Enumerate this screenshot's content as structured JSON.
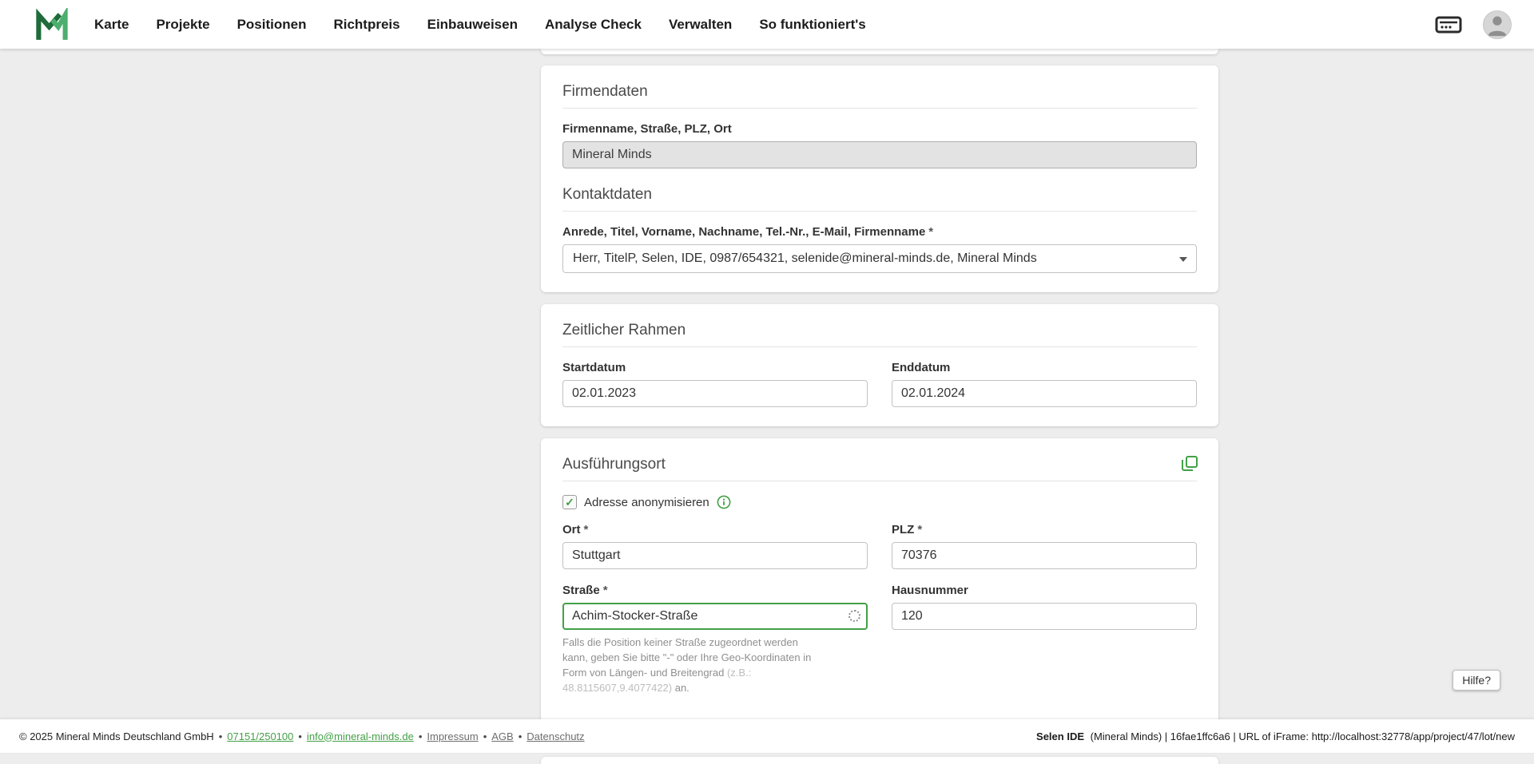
{
  "nav": {
    "items": [
      "Karte",
      "Projekte",
      "Positionen",
      "Richtpreis",
      "Einbauweisen",
      "Analyse Check",
      "Verwalten",
      "So funktioniert's"
    ]
  },
  "icons": {
    "check": "✓"
  },
  "required_marker": "*",
  "cards": {
    "company": {
      "section1_title": "Firmendaten",
      "company_label": "Firmenname, Straße, PLZ, Ort",
      "company_value": "Mineral Minds",
      "section2_title": "Kontaktdaten",
      "contact_label": "Anrede, Titel, Vorname, Nachname, Tel.-Nr., E-Mail, Firmenname",
      "contact_value": "Herr, TitelP, Selen, IDE, 0987/654321, selenide@mineral-minds.de, Mineral Minds"
    },
    "timeframe": {
      "title": "Zeitlicher Rahmen",
      "start_label": "Startdatum",
      "start_value": "02.01.2023",
      "end_label": "Enddatum",
      "end_value": "02.01.2024"
    },
    "location": {
      "title": "Ausführungsort",
      "anonymize_label": "Adresse anonymisieren",
      "city_label": "Ort",
      "city_value": "Stuttgart",
      "zip_label": "PLZ",
      "zip_value": "70376",
      "street_label": "Straße",
      "street_value": "Achim-Stocker-Straße",
      "house_label": "Hausnummer",
      "house_value": "120",
      "hint_text": "Falls die Position keiner Straße zugeordnet werden kann, geben Sie bitte \"-\" oder Ihre Geo-Koordinaten in Form von Längen- und Breitengrad ",
      "hint_example": "(z.B.: 48.8115607,9.4077422)",
      "hint_suffix": " an."
    }
  },
  "help_button": "Hilfe?",
  "footer": {
    "copyright": "© 2025 Mineral Minds Deutschland GmbH",
    "separator": "•",
    "phone": "07151/250100",
    "email": "info@mineral-minds.de",
    "links": [
      "Impressum",
      "AGB",
      "Datenschutz"
    ],
    "right_bold": "Selen IDE",
    "right_rest": "(Mineral Minds) | 16fae1ffc6a6 | URL of iFrame: http://localhost:32778/app/project/47/lot/new"
  }
}
